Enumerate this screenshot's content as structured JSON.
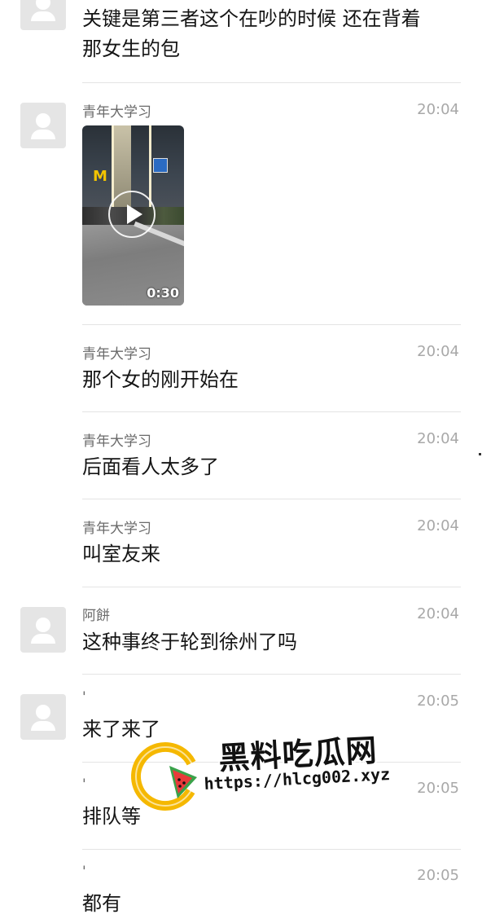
{
  "messages": [
    {
      "name": "",
      "time": "",
      "text_lines": [
        "关键是第三者这个在吵的时候 还在背着",
        "那女生的包"
      ]
    },
    {
      "name": "青年大学习",
      "time": "20:04",
      "video": {
        "duration": "0:30",
        "sign_text": "M"
      }
    },
    {
      "name": "青年大学习",
      "time": "20:04",
      "text": "那个女的刚开始在"
    },
    {
      "name": "青年大学习",
      "time": "20:04",
      "text": "后面看人太多了"
    },
    {
      "name": "青年大学习",
      "time": "20:04",
      "text": "叫室友来"
    },
    {
      "name": "阿餅",
      "time": "20:04",
      "text": "这种事终于轮到徐州了吗"
    },
    {
      "name": "'",
      "time": "20:05",
      "text": "来了来了"
    },
    {
      "name": "'",
      "time": "20:05",
      "text": "排队等"
    },
    {
      "name": "'",
      "time": "20:05",
      "text": "都有"
    }
  ],
  "watermark": {
    "title": "黑料吃瓜网",
    "url": "https://hlcg002.xyz",
    "colors": {
      "ring": "#f5b800",
      "melon_red": "#e83a3a",
      "melon_green": "#3aa24a"
    }
  },
  "icons": {
    "avatar": "default-avatar-icon",
    "play": "play-icon"
  }
}
